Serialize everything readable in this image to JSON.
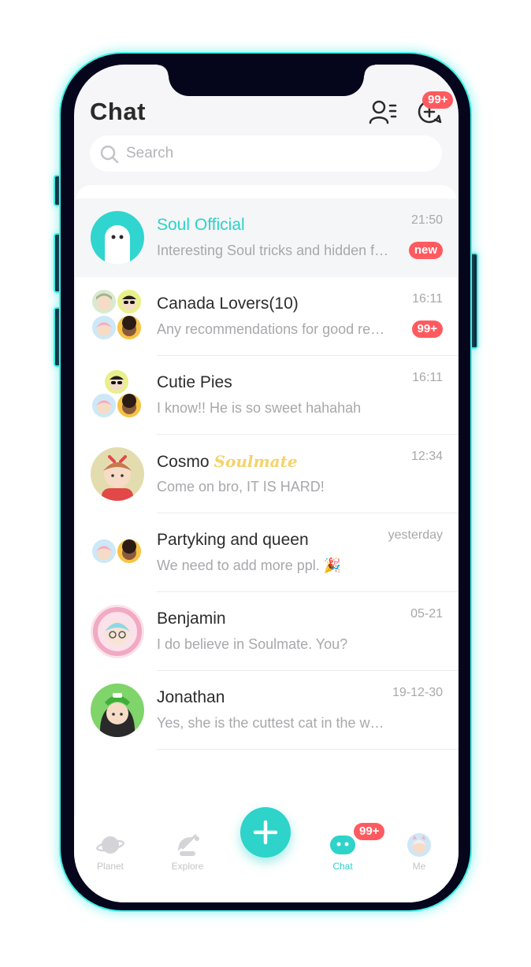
{
  "header": {
    "title": "Chat",
    "notification_badge": "99+",
    "search_placeholder": "Search"
  },
  "chats": [
    {
      "name": "Soul Official",
      "preview": "Interesting Soul tricks and hidden features",
      "time": "21:50",
      "badge": "new",
      "official": true,
      "avatar": "ghost-avatar"
    },
    {
      "name": "Canada Lovers(10)",
      "preview": "Any recommendations for good restaurants?",
      "time": "16:11",
      "badge": "99+",
      "avatar": "group-avatar"
    },
    {
      "name": "Cutie Pies",
      "preview": " I know!! He is so sweet hahahah",
      "time": "16:11",
      "avatar": "group-avatar"
    },
    {
      "name": "Cosmo",
      "tag": "Soulmate",
      "preview": "Come on bro, IT IS HARD!",
      "time": "12:34",
      "avatar": "user-avatar"
    },
    {
      "name": "Partyking and queen",
      "preview": "We need to add more ppl. 🎉",
      "time": "yesterday",
      "avatar": "group-avatar"
    },
    {
      "name": "Benjamin",
      "preview": "I do believe in Soulmate. You?",
      "time": "05-21",
      "avatar": "user-avatar"
    },
    {
      "name": "Jonathan",
      "preview": "Yes, she is the cuttest cat in the world I have ever seen",
      "time": "19-12-30",
      "avatar": "user-avatar"
    }
  ],
  "nav": {
    "items": [
      {
        "label": "Planet",
        "icon": "planet-icon"
      },
      {
        "label": "Explore",
        "icon": "explore-icon"
      },
      {
        "label": "Chat",
        "icon": "chat-icon",
        "active": true,
        "badge": "99+"
      },
      {
        "label": "Me",
        "icon": "avatar"
      }
    ],
    "fab_icon": "plus-icon"
  },
  "colors": {
    "accent": "#2ed3c9",
    "badge": "#ff5a5f",
    "frame_glow": "#3ff0e6",
    "soulmate_tag": "#f4d36a"
  }
}
